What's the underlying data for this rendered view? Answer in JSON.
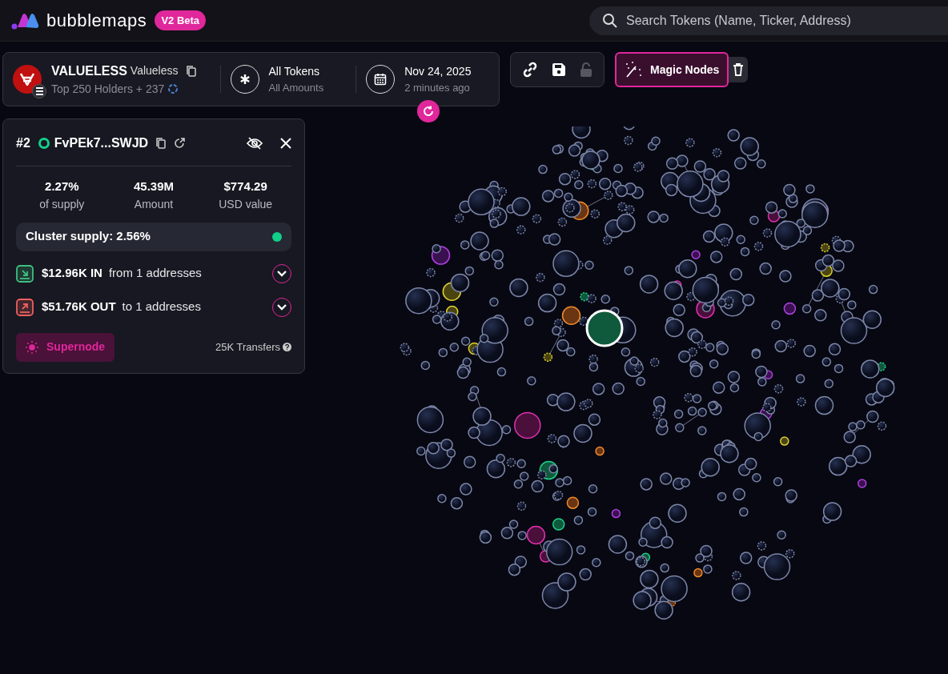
{
  "header": {
    "brand": "bubblemaps",
    "badge": "V2 Beta",
    "search": {
      "placeholder": "Search Tokens (Name, Ticker, Address)"
    }
  },
  "token_panel": {
    "symbol": "VALUELESS",
    "name": "Valueless",
    "holders": "Top 250 Holders + 237",
    "filter": {
      "title": "All Tokens",
      "subtitle": "All Amounts"
    },
    "date": {
      "title": "Nov 24, 2025",
      "subtitle": "2 minutes ago"
    }
  },
  "toolbar": {
    "lock_disabled": true,
    "magic_nodes": {
      "label": "Magic Nodes",
      "selected": true
    }
  },
  "wallet_card": {
    "rank": "#2",
    "address": "FvPEk7...SWJD",
    "stats": [
      {
        "value": "2.27%",
        "label": "of supply"
      },
      {
        "value": "45.39M",
        "label": "Amount"
      },
      {
        "value": "$774.29",
        "label": "USD value"
      }
    ],
    "cluster": {
      "text": "Cluster supply: 2.56%",
      "color": "#10d08a"
    },
    "flows": [
      {
        "kind": "in",
        "amount": "$12.96K IN",
        "detail": "from 1 addresses",
        "expanded": false
      },
      {
        "kind": "out",
        "amount": "$51.76K OUT",
        "detail": "to 1 addresses",
        "expanded": false
      }
    ],
    "supernode": "Supernode",
    "transfers": "25K Transfers"
  }
}
